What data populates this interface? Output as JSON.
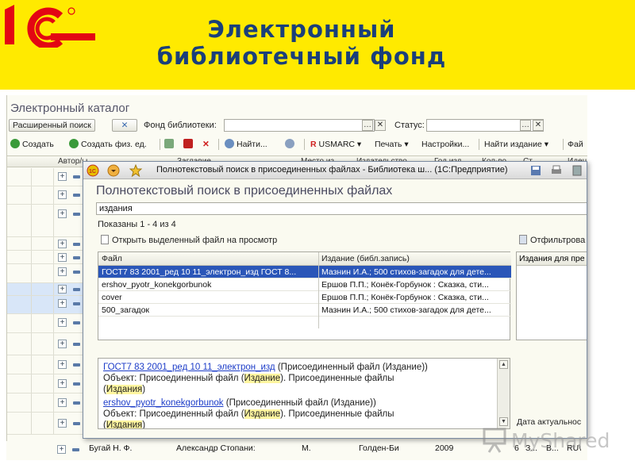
{
  "slide": {
    "title_line1": "Электронный",
    "title_line2": "библиотечный фонд"
  },
  "catalog": {
    "title": "Электронный каталог",
    "advanced_search": "Расширенный поиск",
    "clear_symbol": "✕",
    "fund_label": "Фонд библиотеки:",
    "status_label": "Статус:",
    "toolbar": {
      "create": "Создать",
      "create_person": "Создать физ. ед.",
      "find": "Найти...",
      "usmarc": "USMARC",
      "print": "Печать",
      "settings": "Настройки...",
      "find_edition": "Найти издание",
      "file": "Фай"
    },
    "columns": [
      "Автор/ы",
      "Заглавие",
      "Место из...",
      "Издательство",
      "Год изд.",
      "Кол-во",
      "Ст.",
      "Иден"
    ]
  },
  "dialog": {
    "window_title": "Полнотекстовый поиск в присоединенных файлах - Библиотека ш... (1С:Предприятие)",
    "heading": "Полнотекстовый поиск в присоединенных файлах",
    "query": "издания",
    "shown": "Показаны 1 - 4 из 4",
    "open_file": "Открыть выделенный файл на просмотр",
    "filter": "Отфильтрова",
    "result_columns": {
      "file": "Файл",
      "edition": "Издание (библ.запись)"
    },
    "results": [
      {
        "file": "ГОСТ7 83 2001_ред 10 11_электрон_изд ГОСТ 8...",
        "edition": "Мазнин И.А.; 500 стихов-загадок для дете..."
      },
      {
        "file": "ershov_pyotr_konekgorbunok",
        "edition": "Ершов П.П.; Конёк-Горбунок : Сказка, сти..."
      },
      {
        "file": "cover",
        "edition": "Ершов П.П.; Конёк-Горбунок : Сказка, сти..."
      },
      {
        "file": "500_загадок",
        "edition": "Мазнин И.А.; 500 стихов-загадок для дете..."
      }
    ],
    "side_header": "Издания для пре",
    "date_actual": "Дата актуальнос",
    "snippets": [
      {
        "link": "ГОСТ7 83 2001_ред 10 11_электрон_изд",
        "kind": "(Присоединенный файл (Издание))",
        "object_prefix": "Объект: Присоединенный файл (",
        "object_hl": "Издание",
        "object_suffix": "). Присоединенные файлы",
        "line3_open": "(",
        "line3_hl": "Издания",
        "line3_close": ")"
      },
      {
        "link": "ershov_pyotr_konekgorbunok",
        "kind": "(Присоединенный файл (Издание))",
        "object_prefix": "Объект: Присоединенный файл (",
        "object_hl": "Издание",
        "object_suffix": "). Присоединенные файлы",
        "line3_open": "(",
        "line3_hl": "Издания",
        "line3_close": ")"
      }
    ]
  },
  "bottom_row": {
    "author": "Бугай Н. Ф.",
    "title": "Александр Стопани:",
    "place": "М.",
    "publisher": "Голден-Би",
    "year": "2009",
    "qty": "6",
    "st": "З...",
    "st2": "В...",
    "id": "RU\\"
  },
  "watermark": "MyShared",
  "colors": {
    "banner": "#ffea00",
    "logo_red": "#e30613",
    "title_blue": "#1a3f7a",
    "selection": "#2a56b8"
  }
}
